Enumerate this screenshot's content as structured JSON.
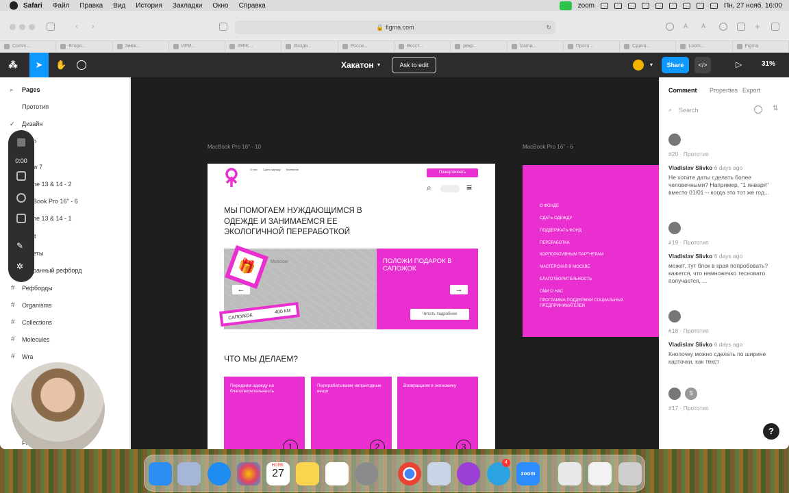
{
  "menubar": {
    "app": "Safari",
    "items": [
      "Файл",
      "Правка",
      "Вид",
      "История",
      "Закладки",
      "Окно",
      "Справка"
    ],
    "zoom_label": "zoom",
    "datetime": "Пн, 27 нояб. 16:00"
  },
  "browser": {
    "url": "figma.com",
    "tabs": [
      "Comm...",
      "Второ...",
      "Завж...",
      "ИРИ...",
      "IREK...",
      "Входя...",
      "Росси...",
      "Восст...",
      "рекр...",
      "Ízama...",
      "Прото...",
      "Сдача...",
      "Loom...",
      "Figma"
    ]
  },
  "figma": {
    "file_title": "Хакатон",
    "ask_to_edit": "Ask to edit",
    "share": "Share",
    "dev_icon": "</>",
    "zoom": "31%"
  },
  "left_panel": {
    "pages_label": "Pages",
    "pages": [
      "Прототип",
      "Дизайн"
    ],
    "partial_items": [
      "h",
      "w 7",
      "ne 13 & 14 - 2",
      "Book Pro 16\" - 6",
      "ne 13 & 14 - 1",
      "it",
      "еты",
      "ранный рефборд"
    ],
    "frames": [
      "Рефборды",
      "Organisms",
      "Collections",
      "Molecules",
      "Wra",
      "Frame 16"
    ],
    "recorder_time": "0:00"
  },
  "canvas": {
    "frame_main_label": "MacBook Pro 16\" - 10",
    "frame_side_label": "MacBook Pro 16\" - 6",
    "mock": {
      "nav": [
        "О нас",
        "Сдать одежду",
        "Компании"
      ],
      "donate": "Пожертвовать",
      "headline": "МЫ ПОМОГАЕМ НУЖДАЮЩИМСЯ В ОДЕЖДЕ И ЗАНИМАЕМСЯ ЕЕ ЭКОЛОГИЧНОЙ ПЕРЕРАБОТКОЙ",
      "map_city": "Moscow",
      "hero_title": "ПОЛОЖИ ПОДАРОК В САПОЖОК",
      "sapozhok": "САПОЖОК",
      "distance": "400 КМ",
      "read_more": "Читать подробнее",
      "what_we_do": "ЧТО МЫ ДЕЛАЕМ?",
      "cards": [
        {
          "title": "Передаем одежду на благотворительность",
          "num": "1"
        },
        {
          "title": "Перерабатываем непригодные вещи",
          "num": "2"
        },
        {
          "title": "Возвращаем в экономику",
          "num": "3"
        }
      ]
    },
    "side_menu": [
      "О ФОНДЕ",
      "СДАТЬ ОДЕЖДУ",
      "ПОДДЕРЖАТЬ ФОНД",
      "ПЕРЕРАБОТКА",
      "КОРПОРАТИВНЫМ ПАРТНЕРАМ",
      "МАСТЕРСКАЯ В МОСКВЕ",
      "БЛАГОТВОРИТЕЛЬНОСТЬ",
      "СМИ О НАС",
      "ПРОГРАММА ПОДДЕРЖКИ СОЦИАЛЬНЫХ ПРЕДПРИНИМАТЕЛЕЙ"
    ]
  },
  "right_panel": {
    "tabs": [
      "Comment",
      "Properties",
      "Export"
    ],
    "search_placeholder": "Search",
    "comments": [
      {
        "meta": "#20 · Прототип",
        "author": "Vladislav Slivko",
        "time": "6 days ago",
        "text": "Не хотите даты сделать более человечными? Например, \"1 января\" вместо 01/01 -- когда это тот же год..."
      },
      {
        "meta": "#19 · Прототип",
        "author": "Vladislav Slivko",
        "time": "6 days ago",
        "text": "может, тут блок в края попробовать? кажется, что немножечко тесновато получается, ..."
      },
      {
        "meta": "#18 · Прототип",
        "author": "Vladislav Slivko",
        "time": "6 days ago",
        "text": "Кнопочку можно сделать по ширине карточки, как текст"
      },
      {
        "meta": "#17 · Прототип",
        "author": "",
        "time": "",
        "text": ""
      }
    ],
    "help": "?"
  },
  "dock": {
    "calendar_month": "НОЯБ.",
    "calendar_day": "27",
    "badge": "4",
    "zoom_label": "zoom"
  },
  "colors": {
    "brand_pink": "#ea2fd0",
    "figma_blue": "#0d99ff",
    "figma_dark": "#2c2c2c"
  }
}
